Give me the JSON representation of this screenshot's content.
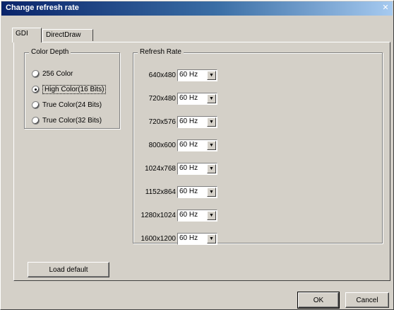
{
  "window": {
    "title": "Change refresh rate",
    "close_glyph": "✕"
  },
  "tabs": [
    {
      "label": "GDI"
    },
    {
      "label": "DirectDraw"
    }
  ],
  "color_depth": {
    "label": "Color Depth",
    "options": [
      {
        "label": "256 Color",
        "checked": false
      },
      {
        "label": "High Color(16 Bits)",
        "checked": true
      },
      {
        "label": "True Color(24 Bits)",
        "checked": false
      },
      {
        "label": "True Color(32 Bits)",
        "checked": false
      }
    ]
  },
  "refresh_rate": {
    "label": "Refresh Rate",
    "rows": [
      {
        "resolution": "640x480",
        "value": "60 Hz"
      },
      {
        "resolution": "720x480",
        "value": "60 Hz"
      },
      {
        "resolution": "720x576",
        "value": "60 Hz"
      },
      {
        "resolution": "800x600",
        "value": "60 Hz"
      },
      {
        "resolution": "1024x768",
        "value": "60 Hz"
      },
      {
        "resolution": "1152x864",
        "value": "60 Hz"
      },
      {
        "resolution": "1280x1024",
        "value": "60 Hz"
      },
      {
        "resolution": "1600x1200",
        "value": "60 Hz"
      }
    ]
  },
  "buttons": {
    "load_default": "Load default",
    "ok": "OK",
    "cancel": "Cancel"
  },
  "icons": {
    "dropdown_arrow": "▼"
  }
}
